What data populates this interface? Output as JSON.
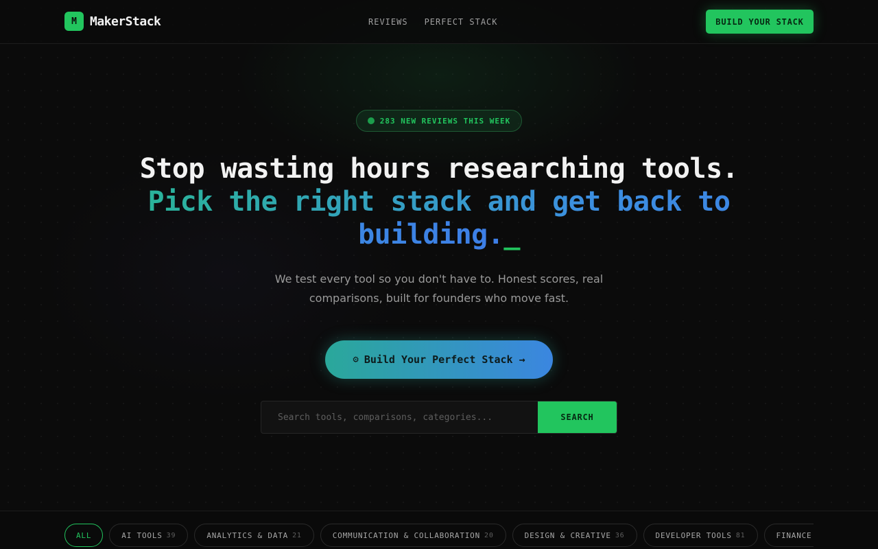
{
  "brand": {
    "logo_letter": "M",
    "name": "MakerStack",
    "accent": "#22c55e"
  },
  "nav": {
    "links": [
      "REVIEWS",
      "PERFECT STACK"
    ],
    "cta_label": "BUILD YOUR STACK"
  },
  "hero": {
    "badge": "283 NEW REVIEWS THIS WEEK",
    "headline_line1": "Stop wasting hours researching tools.",
    "headline_line2": "Pick the right stack and get back to building.",
    "cursor": "_",
    "subtitle": "We test every tool so you don't have to. Honest scores, real comparisons, built for founders who move fast.",
    "cta_icon": "gear-icon",
    "cta_label": "Build Your Perfect Stack →",
    "cta_gradient": [
      "#2aa89a",
      "#3b86e0"
    ]
  },
  "search": {
    "placeholder": "Search tools, comparisons, categories...",
    "button_label": "SEARCH"
  },
  "categories": [
    {
      "label": "ALL",
      "count": ""
    },
    {
      "label": "AI TOOLS",
      "count": "39"
    },
    {
      "label": "ANALYTICS & DATA",
      "count": "21"
    },
    {
      "label": "COMMUNICATION & COLLABORATION",
      "count": "20"
    },
    {
      "label": "DESIGN & CREATIVE",
      "count": "36"
    },
    {
      "label": "DEVELOPER TOOLS",
      "count": "81"
    },
    {
      "label": "FINANCE & ACCO",
      "count": ""
    }
  ]
}
